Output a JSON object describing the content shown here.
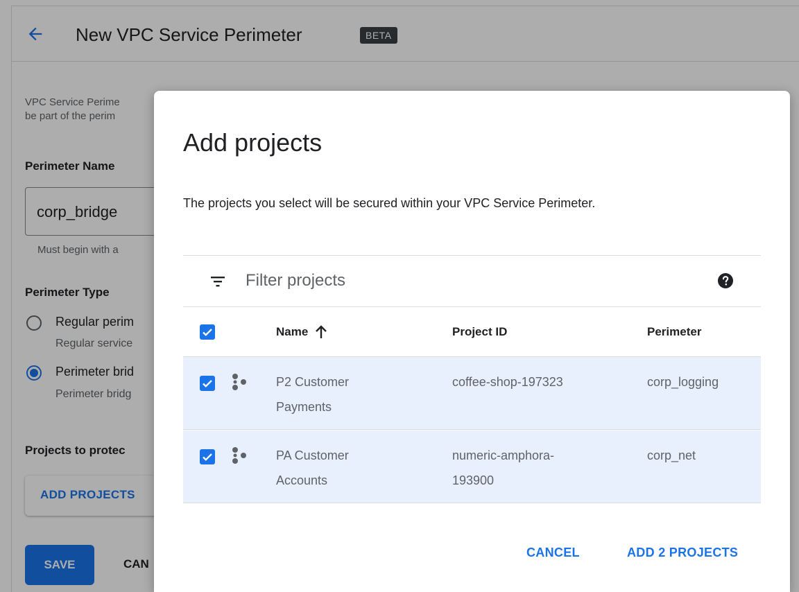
{
  "page": {
    "title": "New VPC Service Perimeter",
    "badge": "BETA",
    "description_line1": "VPC Service Perime",
    "description_line2": "be part of the perim",
    "perimeter_name_label": "Perimeter Name",
    "perimeter_name_value": "corp_bridge",
    "perimeter_name_hint": "Must begin with a",
    "perimeter_type_label": "Perimeter Type",
    "radio_regular_label": "Regular perim",
    "radio_regular_sub": "Regular service",
    "radio_bridge_label": "Perimeter brid",
    "radio_bridge_sub": "Perimeter bridg",
    "projects_label": "Projects to protec",
    "add_projects_button": "ADD PROJECTS",
    "save_button": "SAVE",
    "cancel_button": "CAN"
  },
  "dialog": {
    "title": "Add projects",
    "description": "The projects you select will be secured within your VPC Service Perimeter.",
    "filter_placeholder": "Filter projects",
    "columns": {
      "name": "Name",
      "project_id": "Project ID",
      "perimeter": "Perimeter"
    },
    "rows": [
      {
        "name_line1": "P2 Customer",
        "name_line2": "Payments",
        "project_id_line1": "coffee-shop-197323",
        "project_id_line2": "",
        "perimeter": "corp_logging",
        "checked": true
      },
      {
        "name_line1": "PA Customer",
        "name_line2": "Accounts",
        "project_id_line1": "numeric-amphora-",
        "project_id_line2": "193900",
        "perimeter": "corp_net",
        "checked": true
      }
    ],
    "cancel_button": "CANCEL",
    "confirm_button": "ADD 2 PROJECTS"
  },
  "icons": {
    "back": "arrow-back-icon",
    "filter": "filter-icon",
    "help": "help-icon",
    "sort": "arrow-up-icon",
    "project": "project-icon",
    "checkbox": "checkbox-checked-icon"
  },
  "colors": {
    "accent": "#1a73e8",
    "row_selected": "#e8f0fe",
    "badge": "#3c4043"
  }
}
